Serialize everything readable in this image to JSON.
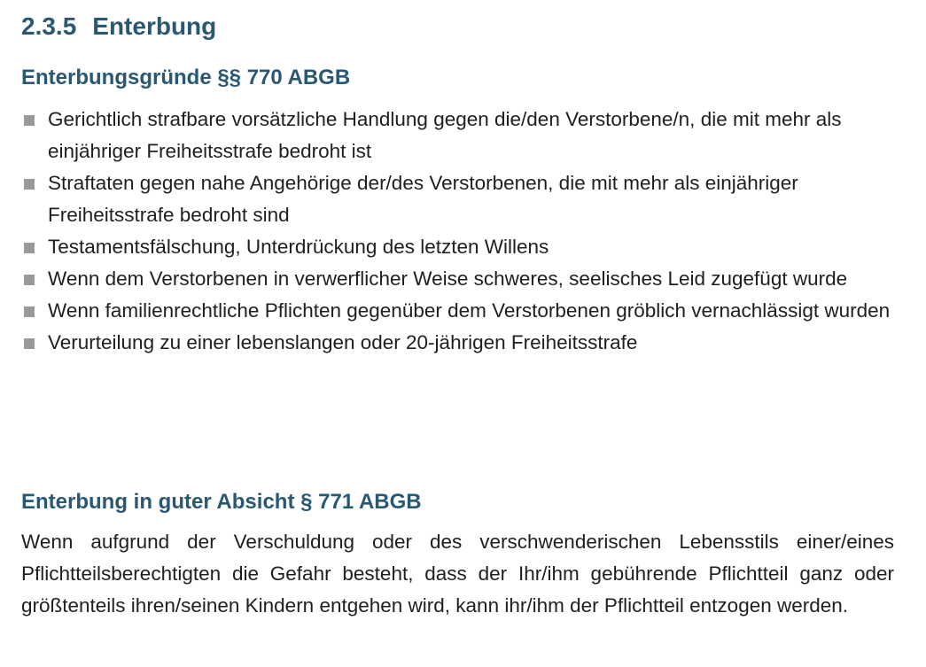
{
  "section": {
    "number": "2.3.5",
    "title": "Enterbung"
  },
  "grounds": {
    "heading": "Enterbungsgründe §§ 770 ABGB",
    "items": [
      "Gerichtlich strafbare vorsätzliche Handlung gegen die/den Verstorbene/n, die mit mehr als einjähriger Freiheitsstrafe bedroht ist",
      "Straftaten gegen nahe Angehörige der/des Verstorbenen, die mit mehr als einjähriger Freiheitsstrafe bedroht sind",
      "Testamentsfälschung, Unterdrückung des letzten Willens",
      "Wenn dem Verstorbenen in verwerflicher Weise schweres, seelisches Leid zugefügt wurde",
      "Wenn familienrechtliche Pflichten gegenüber dem Verstorbenen gröblich vernachlässigt wurden",
      "Verurteilung zu einer lebenslangen oder 20-jährigen Freiheitsstrafe"
    ]
  },
  "good_intent": {
    "heading": "Enterbung in guter Absicht § 771 ABGB",
    "text": "Wenn aufgrund der Verschuldung oder des verschwenderischen Lebensstils einer/eines Pflichtteilsberechtigten die Gefahr besteht, dass der Ihr/ihm gebührende Pflichtteil ganz oder größtenteils ihren/seinen Kindern entgehen wird, kann ihr/ihm der Pflichtteil entzogen werden."
  }
}
